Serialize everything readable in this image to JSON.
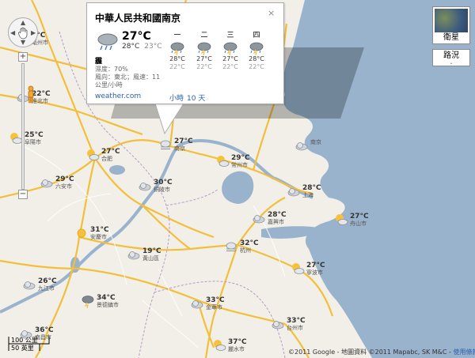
{
  "info_window": {
    "title": "中華人民共和國南京",
    "close": "×",
    "current": {
      "temp": "27°C",
      "high": "28°C",
      "low": "23°C",
      "icon": "rain-icon"
    },
    "condition": "霾",
    "humidity": "濕度：70%",
    "wind": "風向：東北；風速：11",
    "wind_unit": "公里/小時",
    "source_link": "weather.com",
    "hourly_link": "小時",
    "tenday_link": "10 天",
    "forecast": [
      {
        "day": "一",
        "high": "28°C",
        "low": "22°C",
        "icon": "storm-icon"
      },
      {
        "day": "二",
        "high": "27°C",
        "low": "22°C",
        "icon": "storm-icon"
      },
      {
        "day": "三",
        "high": "27°C",
        "low": "22°C",
        "icon": "storm-icon"
      },
      {
        "day": "四",
        "high": "28°C",
        "low": "22°C",
        "icon": "storm-icon"
      }
    ]
  },
  "controls": {
    "zoom_in": "+",
    "zoom_out": "−",
    "map_type": "衛星",
    "traffic": "路況",
    "traffic_drop": "⌄"
  },
  "markers": [
    {
      "temp": "1°C",
      "city": "亳州市",
      "icon": "cloud-icon"
    },
    {
      "temp": "22°C",
      "city": "淮北市",
      "icon": "cloud-icon"
    },
    {
      "temp": "25°C",
      "city": "阜陽市",
      "icon": "sun-cloud-icon"
    },
    {
      "temp": "27°C",
      "city": "合肥",
      "icon": "sun-cloud-icon"
    },
    {
      "temp": "27°C",
      "city": "南京",
      "icon": "haze-icon"
    },
    {
      "temp": "29°C",
      "city": "常州市",
      "icon": "sun-cloud-icon"
    },
    {
      "temp": "29°C",
      "city": "六安市",
      "icon": "cloud-icon"
    },
    {
      "temp": "30°C",
      "city": "銅陵市",
      "icon": "cloud-icon"
    },
    {
      "temp": "28°C",
      "city": "上海",
      "icon": "cloud-icon"
    },
    {
      "temp": "28°C",
      "city": "嘉興市",
      "icon": "cloud-icon"
    },
    {
      "temp": "27°C",
      "city": "舟山市",
      "icon": "sun-cloud-icon"
    },
    {
      "temp": "31°C",
      "city": "安慶市",
      "icon": "sun-icon"
    },
    {
      "temp": "19°C",
      "city": "黃山區",
      "icon": "cloud-icon"
    },
    {
      "temp": "32°C",
      "city": "杭州",
      "icon": "haze-icon"
    },
    {
      "temp": "27°C",
      "city": "寧波市",
      "icon": "sun-cloud-icon"
    },
    {
      "temp": "26°C",
      "city": "九江市",
      "icon": "cloud-icon"
    },
    {
      "temp": "34°C",
      "city": "景德鎮市",
      "icon": "storm-icon"
    },
    {
      "temp": "33°C",
      "city": "金華市",
      "icon": "cloud-icon"
    },
    {
      "temp": "33°C",
      "city": "台州市",
      "icon": "cloud-icon"
    },
    {
      "temp": "36°C",
      "city": "南昌市",
      "icon": "cloud-icon"
    },
    {
      "temp": "37°C",
      "city": "麗水市",
      "icon": "sun-cloud-icon"
    },
    {
      "temp": "",
      "city": "南京",
      "icon": "cloud-icon"
    }
  ],
  "scale": {
    "km": "100 公里",
    "mi": "50 英里"
  },
  "copyright": {
    "text": "©2011 Google - 地圖資料 ©2011 Mapabc, SK M&C - ",
    "terms": "使用條款"
  }
}
